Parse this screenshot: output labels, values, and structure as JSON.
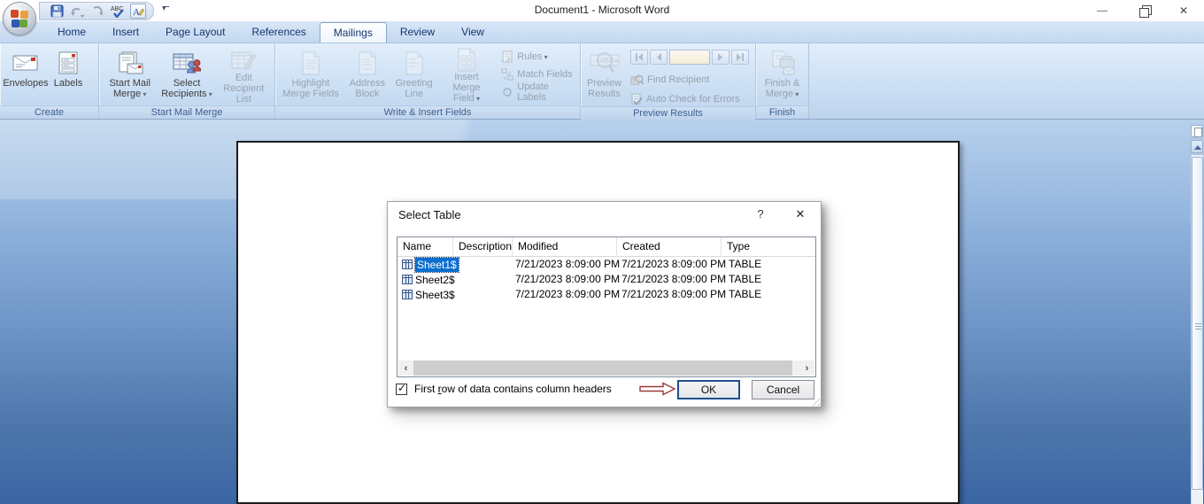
{
  "titlebar": {
    "title": "Document1 - Microsoft Word"
  },
  "qat": {
    "office_button_icon": "office-logo",
    "buttons": [
      {
        "name": "save",
        "icon": "save-icon"
      },
      {
        "name": "undo",
        "icon": "undo-icon"
      },
      {
        "name": "repeat",
        "icon": "repeat-icon"
      },
      {
        "name": "spelling",
        "icon": "spelling-icon"
      },
      {
        "name": "style",
        "icon": "font-style-icon"
      }
    ]
  },
  "tabs": [
    {
      "label": "Home",
      "active": false
    },
    {
      "label": "Insert",
      "active": false
    },
    {
      "label": "Page Layout",
      "active": false
    },
    {
      "label": "References",
      "active": false
    },
    {
      "label": "Mailings",
      "active": true
    },
    {
      "label": "Review",
      "active": false
    },
    {
      "label": "View",
      "active": false
    }
  ],
  "ribbon": {
    "groups": [
      {
        "label": "Create",
        "buttons": [
          {
            "label": "Envelopes",
            "icon": "envelope-icon",
            "enabled": true
          },
          {
            "label": "Labels",
            "icon": "labels-icon",
            "enabled": true
          }
        ]
      },
      {
        "label": "Start Mail Merge",
        "buttons": [
          {
            "label": "Start Mail\nMerge",
            "icon": "start-mail-merge-icon",
            "enabled": true,
            "dropdown": true
          },
          {
            "label": "Select\nRecipients",
            "icon": "select-recipients-icon",
            "enabled": true,
            "dropdown": true
          },
          {
            "label": "Edit\nRecipient List",
            "icon": "edit-recipient-list-icon",
            "enabled": false
          }
        ]
      },
      {
        "label": "Write & Insert Fields",
        "buttons": [
          {
            "label": "Highlight\nMerge Fields",
            "icon": "document-icon",
            "enabled": false
          },
          {
            "label": "Address\nBlock",
            "icon": "document-icon",
            "enabled": false
          },
          {
            "label": "Greeting\nLine",
            "icon": "document-icon",
            "enabled": false
          },
          {
            "label": "Insert Merge\nField",
            "icon": "insert-merge-field-icon",
            "enabled": false,
            "dropdown": true
          }
        ],
        "small_buttons": [
          {
            "label": "Rules",
            "icon": "rules-icon",
            "enabled": false,
            "dropdown": true
          },
          {
            "label": "Match Fields",
            "icon": "match-fields-icon",
            "enabled": false
          },
          {
            "label": "Update Labels",
            "icon": "update-labels-icon",
            "enabled": false
          }
        ]
      },
      {
        "label": "Preview Results",
        "buttons": [
          {
            "label": "Preview\nResults",
            "icon": "preview-results-icon",
            "enabled": false
          }
        ],
        "record_box_value": "",
        "small_buttons": [
          {
            "label": "Find Recipient",
            "icon": "find-recipient-icon",
            "enabled": false
          },
          {
            "label": "Auto Check for Errors",
            "icon": "auto-check-icon",
            "enabled": false
          }
        ]
      },
      {
        "label": "Finish",
        "buttons": [
          {
            "label": "Finish &\nMerge",
            "icon": "finish-merge-icon",
            "enabled": false,
            "dropdown": true
          }
        ]
      }
    ]
  },
  "dialog": {
    "title": "Select Table",
    "help_glyph": "?",
    "close_glyph": "✕",
    "columns": [
      "Name",
      "Description",
      "Modified",
      "Created",
      "Type"
    ],
    "rows": [
      {
        "name": "Sheet1$",
        "description": "",
        "modified": "7/21/2023 8:09:00 PM",
        "created": "7/21/2023 8:09:00 PM",
        "type": "TABLE",
        "selected": true
      },
      {
        "name": "Sheet2$",
        "description": "",
        "modified": "7/21/2023 8:09:00 PM",
        "created": "7/21/2023 8:09:00 PM",
        "type": "TABLE",
        "selected": false
      },
      {
        "name": "Sheet3$",
        "description": "",
        "modified": "7/21/2023 8:09:00 PM",
        "created": "7/21/2023 8:09:00 PM",
        "type": "TABLE",
        "selected": false
      }
    ],
    "checkbox": {
      "checked": true,
      "label_prefix": "First ",
      "label_accel": "r",
      "label_suffix": "ow of data contains column headers"
    },
    "buttons": {
      "ok": "OK",
      "cancel": "Cancel"
    },
    "annotation_arrow_color": "#9b3a3a"
  }
}
